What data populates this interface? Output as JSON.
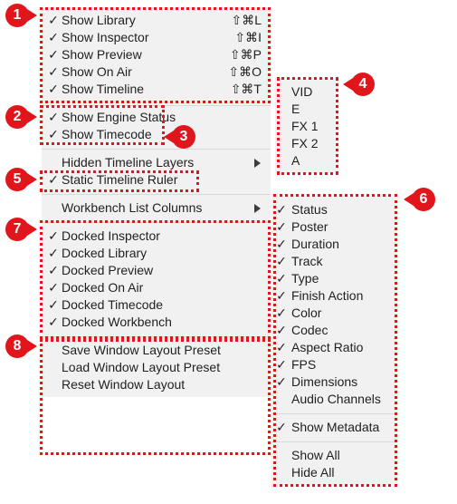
{
  "colors": {
    "menu_bg": "#f1f1f1",
    "annotation_red": "#e0161c",
    "separator": "#d9d9d9"
  },
  "main_menu": {
    "group_windows": [
      {
        "label": "Show Library",
        "checked": true,
        "shortcut": "⇧⌘L"
      },
      {
        "label": "Show Inspector",
        "checked": true,
        "shortcut": "⇧⌘I"
      },
      {
        "label": "Show Preview",
        "checked": true,
        "shortcut": "⇧⌘P"
      },
      {
        "label": "Show On Air",
        "checked": true,
        "shortcut": "⇧⌘O"
      },
      {
        "label": "Show Timeline",
        "checked": true,
        "shortcut": "⇧⌘T"
      }
    ],
    "group_status": [
      {
        "label": "Show Engine Status",
        "checked": true
      },
      {
        "label": "Show Timecode",
        "checked": true
      }
    ],
    "group_timeline": [
      {
        "label": "Hidden Timeline Layers",
        "checked": false,
        "submenu": true
      },
      {
        "label": "Static Timeline Ruler",
        "checked": true
      }
    ],
    "group_columns": [
      {
        "label": "Workbench List Columns",
        "checked": false,
        "submenu": true
      }
    ],
    "group_docked": [
      {
        "label": "Docked Inspector",
        "checked": true
      },
      {
        "label": "Docked Library",
        "checked": true
      },
      {
        "label": "Docked Preview",
        "checked": true
      },
      {
        "label": "Docked On Air",
        "checked": true
      },
      {
        "label": "Docked Timecode",
        "checked": true
      },
      {
        "label": "Docked Workbench",
        "checked": true
      }
    ],
    "group_presets": [
      {
        "label": "Save Window Layout Preset"
      },
      {
        "label": "Load Window Layout Preset"
      },
      {
        "label": "Reset Window Layout"
      }
    ]
  },
  "layers_submenu": {
    "items": [
      "VID",
      "E",
      "FX 1",
      "FX 2",
      "A"
    ]
  },
  "columns_submenu": {
    "items": [
      {
        "label": "Status",
        "checked": true
      },
      {
        "label": "Poster",
        "checked": true
      },
      {
        "label": "Duration",
        "checked": true
      },
      {
        "label": "Track",
        "checked": true
      },
      {
        "label": "Type",
        "checked": true
      },
      {
        "label": "Finish Action",
        "checked": true
      },
      {
        "label": "Color",
        "checked": true
      },
      {
        "label": "Codec",
        "checked": true
      },
      {
        "label": "Aspect Ratio",
        "checked": true
      },
      {
        "label": "FPS",
        "checked": true
      },
      {
        "label": "Dimensions",
        "checked": true
      },
      {
        "label": "Audio Channels",
        "checked": false
      }
    ],
    "metadata": {
      "label": "Show Metadata",
      "checked": true
    },
    "actions": [
      "Show All",
      "Hide All"
    ]
  },
  "check_glyph": "✓",
  "badges": [
    "1",
    "2",
    "3",
    "4",
    "5",
    "6",
    "7",
    "8"
  ]
}
